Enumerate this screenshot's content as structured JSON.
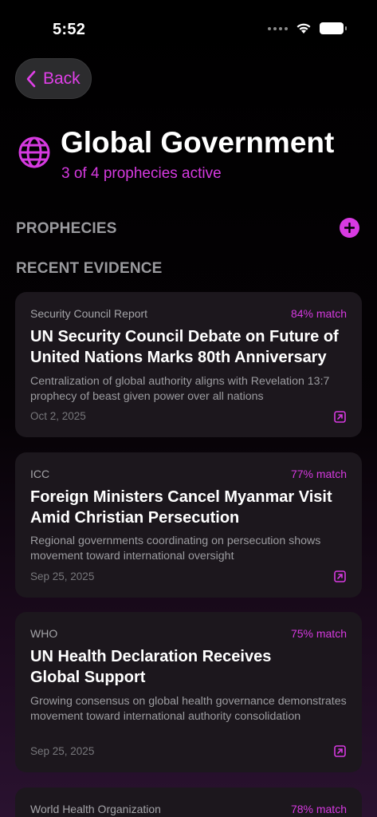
{
  "status": {
    "time": "5:52"
  },
  "nav": {
    "back_label": "Back"
  },
  "header": {
    "icon": "globe-icon",
    "title": "Global Government",
    "subtitle": "3 of 4 prophecies active"
  },
  "sections": {
    "prophecies": "PROPHECIES",
    "recent_evidence": "RECENT EVIDENCE"
  },
  "evidence": [
    {
      "source": "Security Council Report",
      "match": "84% match",
      "title": "UN Security Council Debate on Future of United Nations Marks 80th Anniversary",
      "summary": "Centralization of global authority aligns with Revelation 13:7 prophecy of beast given power over all nations",
      "date": "Oct 2, 2025"
    },
    {
      "source": "ICC",
      "match": "77% match",
      "title": "Foreign Ministers Cancel Myanmar Visit Amid Christian Persecution",
      "summary": "Regional governments coordinating on persecution shows movement toward international oversight",
      "date": "Sep 25, 2025"
    },
    {
      "source": "WHO",
      "match": "75% match",
      "title": "UN Health Declaration Receives Global Support",
      "summary": "Growing consensus on global health governance demonstrates movement toward international authority consolidation",
      "date": "Sep 25, 2025"
    },
    {
      "source": "World Health Organization",
      "match": "78% match"
    }
  ],
  "colors": {
    "accent": "#d63ae0",
    "background": "#000000",
    "card": "#1c171d"
  }
}
